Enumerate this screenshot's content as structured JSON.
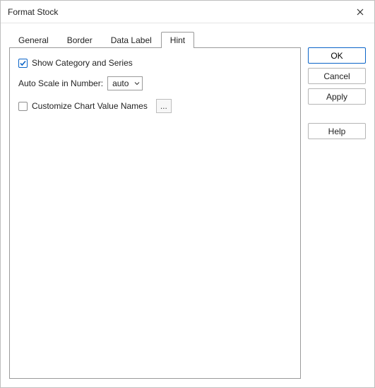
{
  "window": {
    "title": "Format Stock"
  },
  "tabs": {
    "items": [
      "General",
      "Border",
      "Data Label",
      "Hint"
    ],
    "active_index": 3
  },
  "hint_panel": {
    "show_cat_series": {
      "label": "Show Category and Series",
      "checked": true
    },
    "auto_scale": {
      "label": "Auto Scale in Number:",
      "value": "auto"
    },
    "custom_names": {
      "label": "Customize Chart Value Names",
      "checked": false,
      "more": "..."
    }
  },
  "buttons": {
    "ok": "OK",
    "cancel": "Cancel",
    "apply": "Apply",
    "help": "Help"
  }
}
